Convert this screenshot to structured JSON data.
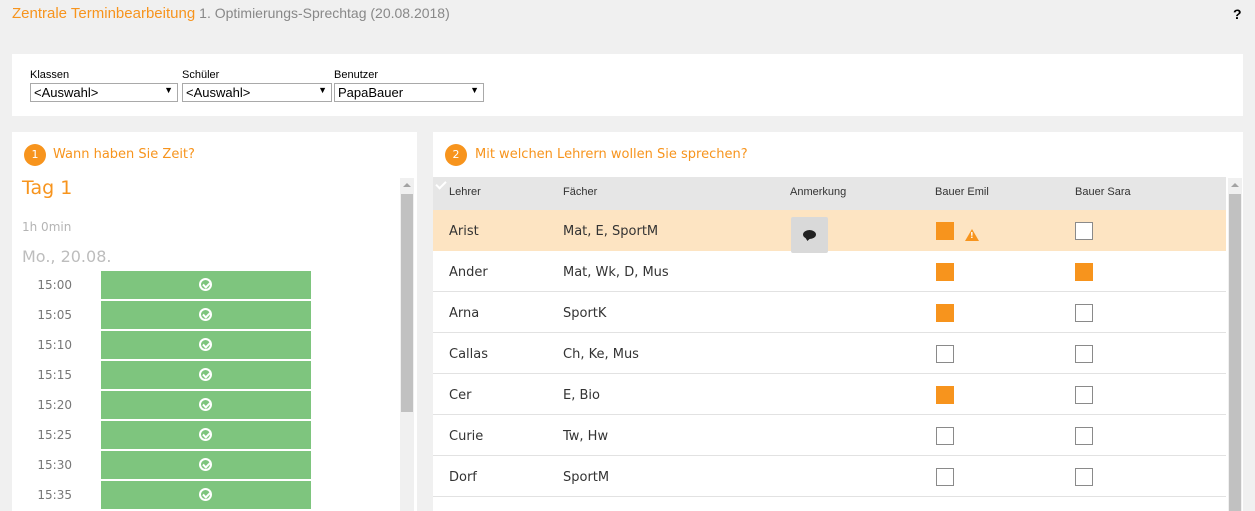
{
  "header": {
    "title": "Zentrale Terminbearbeitung",
    "subtitle": "1. Optimierungs-Sprechtag (20.08.2018)",
    "help_label": "?"
  },
  "filters": {
    "klassen": {
      "label": "Klassen",
      "value": "<Auswahl>"
    },
    "schueler": {
      "label": "Schüler",
      "value": "<Auswahl>"
    },
    "benutzer": {
      "label": "Benutzer",
      "value": "PapaBauer"
    }
  },
  "left_panel": {
    "step": "1",
    "title": "Wann haben Sie Zeit?",
    "day_label": "Tag 1",
    "duration": "1h 0min",
    "date": "Mo., 20.08.",
    "slots": [
      "15:00",
      "15:05",
      "15:10",
      "15:15",
      "15:20",
      "15:25",
      "15:30",
      "15:35"
    ]
  },
  "right_panel": {
    "step": "2",
    "title": "Mit welchen Lehrern wollen Sie sprechen?",
    "columns": {
      "lehrer": "Lehrer",
      "faecher": "Fächer",
      "anmerkung": "Anmerkung",
      "student1": "Bauer Emil",
      "student2": "Bauer Sara"
    },
    "rows": [
      {
        "teacher": "Arist",
        "subjects": "Mat, E, SportM",
        "has_note": true,
        "emil": true,
        "sara": false,
        "emil_warning": true,
        "selected": true
      },
      {
        "teacher": "Ander",
        "subjects": "Mat, Wk, D, Mus",
        "has_note": false,
        "emil": true,
        "sara": true,
        "emil_warning": false,
        "selected": false
      },
      {
        "teacher": "Arna",
        "subjects": "SportK",
        "has_note": false,
        "emil": true,
        "sara": false,
        "emil_warning": false,
        "selected": false
      },
      {
        "teacher": "Callas",
        "subjects": "Ch, Ke, Mus",
        "has_note": false,
        "emil": false,
        "sara": false,
        "emil_warning": false,
        "selected": false
      },
      {
        "teacher": "Cer",
        "subjects": "E, Bio",
        "has_note": false,
        "emil": true,
        "sara": false,
        "emil_warning": false,
        "selected": false
      },
      {
        "teacher": "Curie",
        "subjects": "Tw, Hw",
        "has_note": false,
        "emil": false,
        "sara": false,
        "emil_warning": false,
        "selected": false
      },
      {
        "teacher": "Dorf",
        "subjects": "SportM",
        "has_note": false,
        "emil": false,
        "sara": false,
        "emil_warning": false,
        "selected": false
      }
    ]
  },
  "colors": {
    "accent": "#f7941d",
    "slot_available": "#7ec57e",
    "selected_row": "#fde4c2"
  },
  "icons": {
    "note": "speech-bubble-icon",
    "warning": "warning-triangle-icon",
    "slot": "check-circle-icon"
  }
}
